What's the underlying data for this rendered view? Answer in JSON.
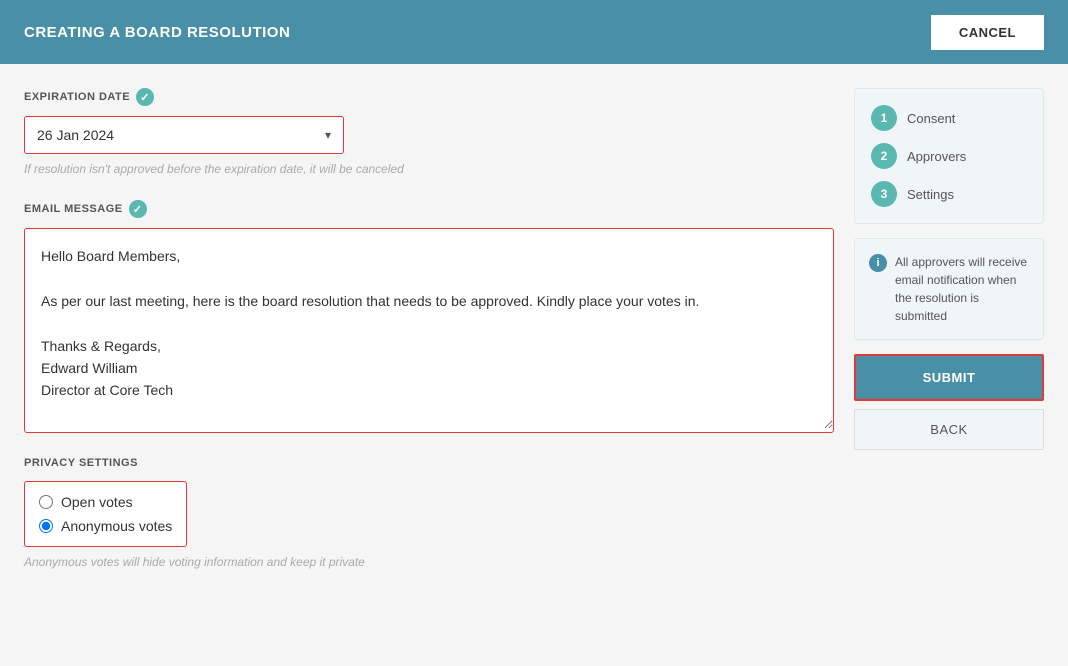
{
  "header": {
    "title": "CREATING A BOARD RESOLUTION",
    "cancel_label": "CANCEL"
  },
  "expiration_date": {
    "label": "EXPIRATION DATE",
    "value": "26 Jan 2024",
    "hint": "If resolution isn't approved before the expiration date, it will be canceled"
  },
  "email_message": {
    "label": "EMAIL MESSAGE",
    "value": "Hello Board Members,\n\nAs per our last meeting, here is the board resolution that needs to be approved. Kindly place your votes in.\n\nThanks & Regards,\nEdward William\nDirector at Core Tech"
  },
  "privacy_settings": {
    "label": "PRIVACY SETTINGS",
    "options": [
      {
        "label": "Open votes",
        "value": "open",
        "checked": false
      },
      {
        "label": "Anonymous votes",
        "value": "anonymous",
        "checked": true
      }
    ],
    "hint": "Anonymous votes will hide voting information and keep it private"
  },
  "sidebar": {
    "steps": [
      {
        "number": "1",
        "label": "Consent"
      },
      {
        "number": "2",
        "label": "Approvers"
      },
      {
        "number": "3",
        "label": "Settings"
      }
    ],
    "info_text": "All approvers will receive email notification when the resolution is submitted"
  },
  "buttons": {
    "submit_label": "SUBMIT",
    "back_label": "BACK"
  }
}
